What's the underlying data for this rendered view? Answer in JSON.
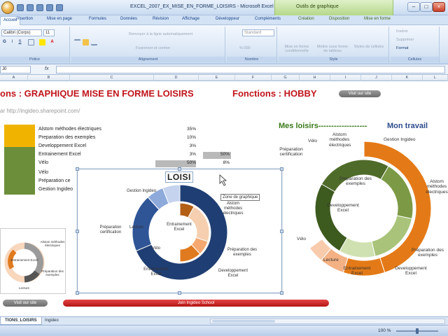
{
  "window": {
    "title": "EXCEL_2007_EX_MISE_EN_FORME_LOISIRS - Microsoft Excel",
    "context_title": "Outils de graphique",
    "buttons": [
      "–",
      "□",
      "×"
    ]
  },
  "tabs": [
    {
      "label": "Accueil",
      "active": true
    },
    {
      "label": "Insertion"
    },
    {
      "label": "Mise en page"
    },
    {
      "label": "Formules"
    },
    {
      "label": "Données"
    },
    {
      "label": "Révision"
    },
    {
      "label": "Affichage"
    },
    {
      "label": "Développeur"
    },
    {
      "label": "Compléments"
    },
    {
      "label": "Création",
      "context": true
    },
    {
      "label": "Disposition",
      "context": true
    },
    {
      "label": "Mise en forme",
      "context": true
    }
  ],
  "ribbon": {
    "font_name": "Calibri (Corps)",
    "font_size": "11",
    "number_format": "Standard",
    "wrap_text": "Renvoyer à la ligne automatiquement",
    "merge_center": "Fusionner et centrer",
    "percent": "% 000",
    "cond_format": "Mise en forme conditionnelle",
    "format_table": "Mettre sous forme de tableau",
    "cell_styles": "Styles de cellules",
    "insert": "Insérer",
    "delete": "Supprimer",
    "format": "Format",
    "groups": [
      "Police",
      "Alignement",
      "Nombre",
      "Style",
      "Cellules"
    ]
  },
  "formula_bar": {
    "name_box": "J0",
    "fx": "fx"
  },
  "columns": [
    "A",
    "B",
    "C",
    "D",
    "E",
    "F",
    "G",
    "H",
    "I",
    "J",
    "K",
    "L"
  ],
  "sheet": {
    "heading_left": "ons : GRAPHIQUE MISE EN FORME LOISIRS",
    "heading_right": "Fonctions : HOBBY",
    "visit_button": "Visit our site",
    "subtitle": "ar http://ingideo.sharepoint.com/",
    "join_button": "Join Ingideo School",
    "visit_button2": "Visit our site",
    "title_mes_loisirs": "Mes loisirs-------------------",
    "title_mon_travail": "Mon travail"
  },
  "table": {
    "rows": [
      {
        "label": "Alstom méthodes électriques",
        "pct": "35%",
        "pct2": ""
      },
      {
        "label": "Preparation des exemples",
        "pct": "10%",
        "pct2": ""
      },
      {
        "label": "Developpement Excel",
        "pct": "3%",
        "pct2": ""
      },
      {
        "label": "Entrainement Excel",
        "pct": "3%",
        "pct2": "50%"
      },
      {
        "label": "Vélo",
        "pct": "50%",
        "pct2": "8%"
      },
      {
        "label": "Préparation ce",
        "pct": "",
        "pct2": ""
      },
      {
        "label": "Gestion Ingideo",
        "pct": "",
        "pct2": ""
      }
    ],
    "swatch_colors": [
      "#f0b400",
      "#6c8e3a"
    ]
  },
  "chart": {
    "title": "LOISI",
    "tooltip": "Zone de graphique",
    "labels": [
      "Gestion Ingideo",
      "Alstom méthodes électriques",
      "Préparation certification",
      "Lecture",
      "Entrainement Excel",
      "Vélo",
      "Entrainement Excel",
      "Préparation des exemples",
      "Developpement Excel"
    ]
  },
  "chart_data": [
    {
      "type": "pie",
      "title": "LOISI",
      "inner_ring": {
        "categories": [
          "Entrainement Excel",
          "Vélo",
          "Lecture",
          "Préparation certification",
          "Gestion Ingideo"
        ],
        "values": [
          50,
          8,
          22,
          8,
          12
        ],
        "colors": [
          "#ffffff",
          "#b35f14",
          "#f5cfb0",
          "#f5a870",
          "#e07a1f"
        ]
      },
      "outer_ring": {
        "categories": [
          "Alstom méthodes électriques",
          "Préparation des exemples",
          "Developpement Excel",
          "Entrainement Excel"
        ],
        "values": [
          35,
          10,
          3,
          3
        ],
        "colors": [
          "#1f3e73",
          "#2f5597",
          "#8eaadb",
          "#c5d3ee"
        ]
      }
    },
    {
      "type": "pie",
      "title": "",
      "inner_ring": {
        "categories": [
          "Gestion Ingideo",
          "Vélo",
          "Lecture",
          "Entrainement Excel",
          "Préparation certification"
        ],
        "values": [
          25,
          20,
          18,
          12,
          25
        ],
        "colors": [
          "#4f6b2a",
          "#7c9a45",
          "#a9c47a",
          "#cfe1b0",
          "#3d5a1f"
        ]
      },
      "outer_ring": {
        "categories": [
          "Gestion Ingideo",
          "Alstom méthodes électriques",
          "Developpement Excel",
          "Entrainement Excel",
          "Lecture"
        ],
        "values": [
          45,
          10,
          6,
          4,
          35
        ],
        "colors": [
          "#e47a17",
          "#e47a17",
          "#f4b183",
          "#f8cbad",
          "#ffffff"
        ]
      }
    }
  ],
  "big_chart_labels": [
    "Gestion Ingideo",
    "Alstom méthodes électriques",
    "Préparation certification",
    "Vélo",
    "Preparation des exemples",
    "Developpement Excel",
    "Vélo",
    "Lecture",
    "Entrainement Excel",
    "Developpement Excel",
    "Préparation des exemples",
    "Alstom méthodes électriques"
  ],
  "mini_chart_labels": [
    "Alstom méthodes électriques",
    "Entrainement Excel",
    "Préparation des exemples",
    "Lecture"
  ],
  "sheet_tabs": [
    "TIONS_LOISIRS",
    "Ingideo"
  ],
  "status": {
    "zoom": "100 %"
  }
}
